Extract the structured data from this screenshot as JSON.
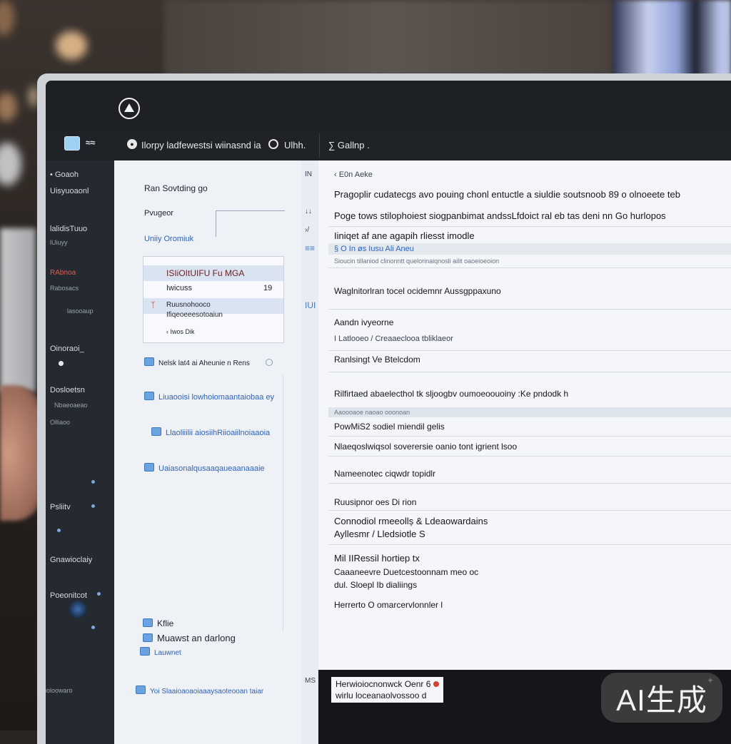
{
  "nav": {
    "menu_label": "≈≈",
    "link_icon": "link-icon",
    "title": "Ilorpy ladfewestsi wiinasnd ia",
    "user_label": "Ulhh.",
    "settings_label": "∑ Gallnp ."
  },
  "sidebar": {
    "items": [
      "• Goaoh",
      "Uisyuoaonl",
      "lalidisTuuo",
      "lUiuyy",
      "RAbnoa",
      "Rabosacs",
      "lasooaup",
      "Oinoraoi_",
      "Dosloetsn",
      "Nbaeoaeao",
      "Olliaoo",
      "Psliitv",
      "Gnawioclaiy",
      "Poeonitcot",
      "uoloowaro"
    ]
  },
  "midpanel": {
    "heading": "Ran Sovtding go",
    "sub": "Pvugeor",
    "link": "Uniiy Oromiuk",
    "box_title": "ISIiOItUIFU Fu MGA",
    "box_value": "Iwicuss",
    "box_value_num": "19",
    "box_item": "Ruusnohooco",
    "box_item_sub": "Ifiqeoeeesotoaiun",
    "box_item_foot": "‹ Iwos Dik",
    "row1": "Nelsk lat4 ai Aheunie n Rens",
    "row2": "Liuaooisi lowhoiomaantaiobaa ey",
    "row3": "Llaoliiilii aiosiihRiioaiilnoiaaoia",
    "row4": "Uaiasonalqusaaqaueaanaaaie",
    "bottom1": "Kflie",
    "bottom2": "Muawst an darlong",
    "bottom3": "Lauwnet",
    "bottom4": "Yoi Slaaioaoaoiaaaysaoteooan taiar"
  },
  "gutter": [
    "IN",
    "↓↓",
    "›/",
    "≡≡",
    "IUI",
    "MS"
  ],
  "main": {
    "header": "‹ E0n Aeke",
    "line1": "Pragoplir cudatecgs avo pouing chonl entuctle a siuldie soutsnoob 89 o olnoeete teb",
    "line2": "Poge tows stilophoiest siogpanbimat andssLfdoict ral eb tas deni nn Go hurlopos",
    "line3": "Iiniqet af ane agapih rliesst imodle",
    "line4": "§ O In øs Iusu Ali Aneu",
    "line5": "Sioucin tillaniod clinonntt quelorinaiqnosli ailit oaoeioeoion",
    "line6": "Waglnitorlran tocel ocidemnr Aussgppaxuno",
    "line7": "Aandn ivyeorne",
    "line8": "I Latlooeo / Creaaeclooa tbliklaeor",
    "line9": "Ranlsingt Ve Btelcdom",
    "line10": "Rilfirtaed abaelecthol tk sljoogbv oumoeoouoiny :Ke pndodk h",
    "line11": "Aaoooaoe naoao ooonoan",
    "line12": "PowMiS2 sodiel miendil gelis",
    "line13": "Nlaeqoslwiqsol soverersie oanio tont igrient lsoo",
    "line14": "Nameenotec ciqwdr topidlr",
    "line15": "Ruusipnor oes Di rion",
    "line16": "Connodiol rmeeollș & Ldeaowardains",
    "line17": "Ayllesmr / Lledsiotle S",
    "line18": "Mil IIRessil hortiep tx",
    "line19": "Caaaneevre Duetcestoonnam meo oc",
    "line20": "dul. Sloepl Ib dialiings",
    "line21": "Herrerto O omarcervlonnler l"
  },
  "footer": {
    "line1": "Herwioiocnonwck Oenr 6",
    "line2": "wirlu loceanaolvossoo d"
  },
  "watermark": "AI生成"
}
